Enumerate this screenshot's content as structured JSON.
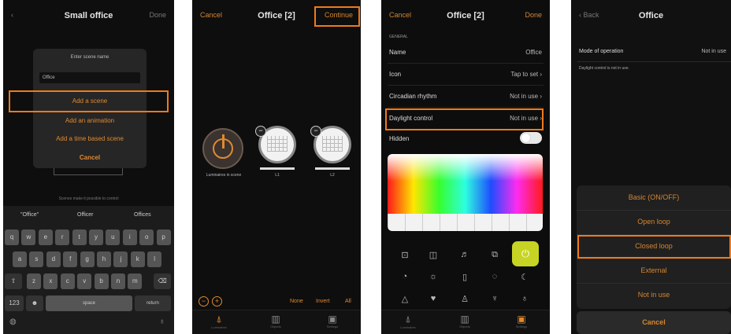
{
  "screen1": {
    "title": "Small office",
    "back": "‹",
    "right": "Done",
    "dialog_title": "Enter scene name",
    "input_value": "Office",
    "add_scene": "Add a scene",
    "add_animation": "Add an animation",
    "add_time": "Add a time based scene",
    "cancel": "Cancel",
    "hint": "Scenes make it possible to control",
    "suggestions": [
      "\"Office\"",
      "Officer",
      "Offices"
    ],
    "row1": [
      "q",
      "w",
      "e",
      "r",
      "t",
      "y",
      "u",
      "i",
      "o",
      "p"
    ],
    "row2": [
      "a",
      "s",
      "d",
      "f",
      "g",
      "h",
      "j",
      "k",
      "l"
    ],
    "row3": [
      "z",
      "x",
      "c",
      "v",
      "b",
      "n",
      "m"
    ],
    "space": "space",
    "return": "return",
    "num": "123"
  },
  "screen2": {
    "cancel": "Cancel",
    "title": "Office [2]",
    "continue": "Continue",
    "lum_label": "Luminaires in scene",
    "l1": "L1",
    "l2": "L2",
    "none": "None",
    "invert": "Invert",
    "all": "All",
    "tabs": [
      "Luminaires",
      "Objects",
      "Settings"
    ]
  },
  "screen3": {
    "cancel": "Cancel",
    "title": "Office [2]",
    "done": "Done",
    "section": "GENERAL",
    "rows": [
      {
        "label": "Name",
        "value": "Office"
      },
      {
        "label": "Icon",
        "value": "Tap to set ›"
      },
      {
        "label": "Circadian rhythm",
        "value": "Not in use ›"
      },
      {
        "label": "Daylight control",
        "value": "Not in use ›"
      },
      {
        "label": "Hidden",
        "value": ""
      }
    ],
    "tabs": [
      "Luminaires",
      "Objects",
      "Settings"
    ]
  },
  "screen4": {
    "back": "‹ Back",
    "title": "Office",
    "mode_label": "Mode of operation",
    "mode_value": "Not in use",
    "note": "Daylight control is not in use.",
    "options": [
      "Basic (ON/OFF)",
      "Open loop",
      "Closed loop",
      "External",
      "Not in use"
    ],
    "cancel": "Cancel"
  }
}
